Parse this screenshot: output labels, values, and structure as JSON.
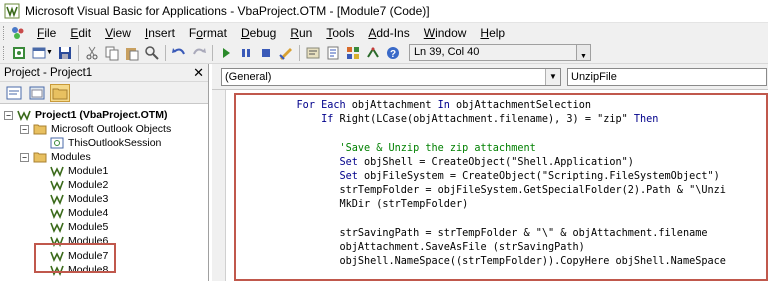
{
  "window": {
    "title": "Microsoft Visual Basic for Applications - VbaProject.OTM - [Module7 (Code)]",
    "icon": "vba-app-icon"
  },
  "menubar": {
    "items": [
      {
        "underline": "F",
        "rest": "ile"
      },
      {
        "underline": "E",
        "rest": "dit"
      },
      {
        "underline": "V",
        "rest": "iew"
      },
      {
        "underline": "I",
        "rest": "nsert"
      },
      {
        "prefix": "F",
        "underline": "o",
        "rest": "rmat"
      },
      {
        "underline": "D",
        "rest": "ebug"
      },
      {
        "underline": "R",
        "rest": "un"
      },
      {
        "underline": "T",
        "rest": "ools"
      },
      {
        "underline": "A",
        "rest": "dd-Ins"
      },
      {
        "underline": "W",
        "rest": "indow"
      },
      {
        "underline": "H",
        "rest": "elp"
      }
    ]
  },
  "toolbar": {
    "status": "Ln 39, Col 40",
    "buttons": [
      "view-outlook-icon",
      "insert-module-icon",
      "save-icon",
      "cut-icon",
      "copy-icon",
      "paste-icon",
      "find-icon",
      "undo-icon",
      "redo-icon",
      "run-icon",
      "break-icon",
      "reset-icon",
      "design-mode-icon",
      "project-explorer-icon",
      "properties-icon",
      "object-browser-icon",
      "toolbox-icon",
      "help-icon"
    ]
  },
  "project_panel": {
    "title": "Project - Project1",
    "tree": {
      "root": "Project1 (VbaProject.OTM)",
      "outlook_folder": "Microsoft Outlook Objects",
      "session": "ThisOutlookSession",
      "modules_folder": "Modules",
      "modules": [
        "Module1",
        "Module2",
        "Module3",
        "Module4",
        "Module5",
        "Module6",
        "Module7",
        "Module8"
      ]
    }
  },
  "code_window": {
    "object_combo": "(General)",
    "procedure_combo": "UnzipFile",
    "lines": [
      {
        "indent": "    ",
        "tokens": [
          {
            "k": "kw",
            "t": "For Each"
          },
          {
            "k": "tx",
            "t": " objAttachment "
          },
          {
            "k": "kw",
            "t": "In"
          },
          {
            "k": "tx",
            "t": " objAttachmentSelection"
          }
        ]
      },
      {
        "indent": "        ",
        "tokens": [
          {
            "k": "kw",
            "t": "If"
          },
          {
            "k": "tx",
            "t": " Right(LCase(objAttachment.filename), 3) = \"zip\" "
          },
          {
            "k": "kw",
            "t": "Then"
          }
        ]
      },
      {
        "indent": "",
        "tokens": []
      },
      {
        "indent": "           ",
        "tokens": [
          {
            "k": "cm",
            "t": "'Save & Unzip the zip attachment"
          }
        ]
      },
      {
        "indent": "           ",
        "tokens": [
          {
            "k": "kw",
            "t": "Set"
          },
          {
            "k": "tx",
            "t": " objShell = CreateObject(\"Shell.Application\")"
          }
        ]
      },
      {
        "indent": "           ",
        "tokens": [
          {
            "k": "kw",
            "t": "Set"
          },
          {
            "k": "tx",
            "t": " objFileSystem = CreateObject(\"Scripting.FileSystemObject\")"
          }
        ]
      },
      {
        "indent": "           ",
        "tokens": [
          {
            "k": "tx",
            "t": "strTempFolder = objFileSystem.GetSpecialFolder(2).Path & \"\\Unzi"
          }
        ]
      },
      {
        "indent": "           ",
        "tokens": [
          {
            "k": "tx",
            "t": "MkDir (strTempFolder)"
          }
        ]
      },
      {
        "indent": "",
        "tokens": []
      },
      {
        "indent": "           ",
        "tokens": [
          {
            "k": "tx",
            "t": "strSavingPath = strTempFolder & \"\\\" & objAttachment.filename"
          }
        ]
      },
      {
        "indent": "           ",
        "tokens": [
          {
            "k": "tx",
            "t": "objAttachment.SaveAsFile (strSavingPath)"
          }
        ]
      },
      {
        "indent": "           ",
        "tokens": [
          {
            "k": "tx",
            "t": "objShell.NameSpace((strTempFolder)).CopyHere objShell.NameSpace"
          }
        ]
      }
    ]
  }
}
